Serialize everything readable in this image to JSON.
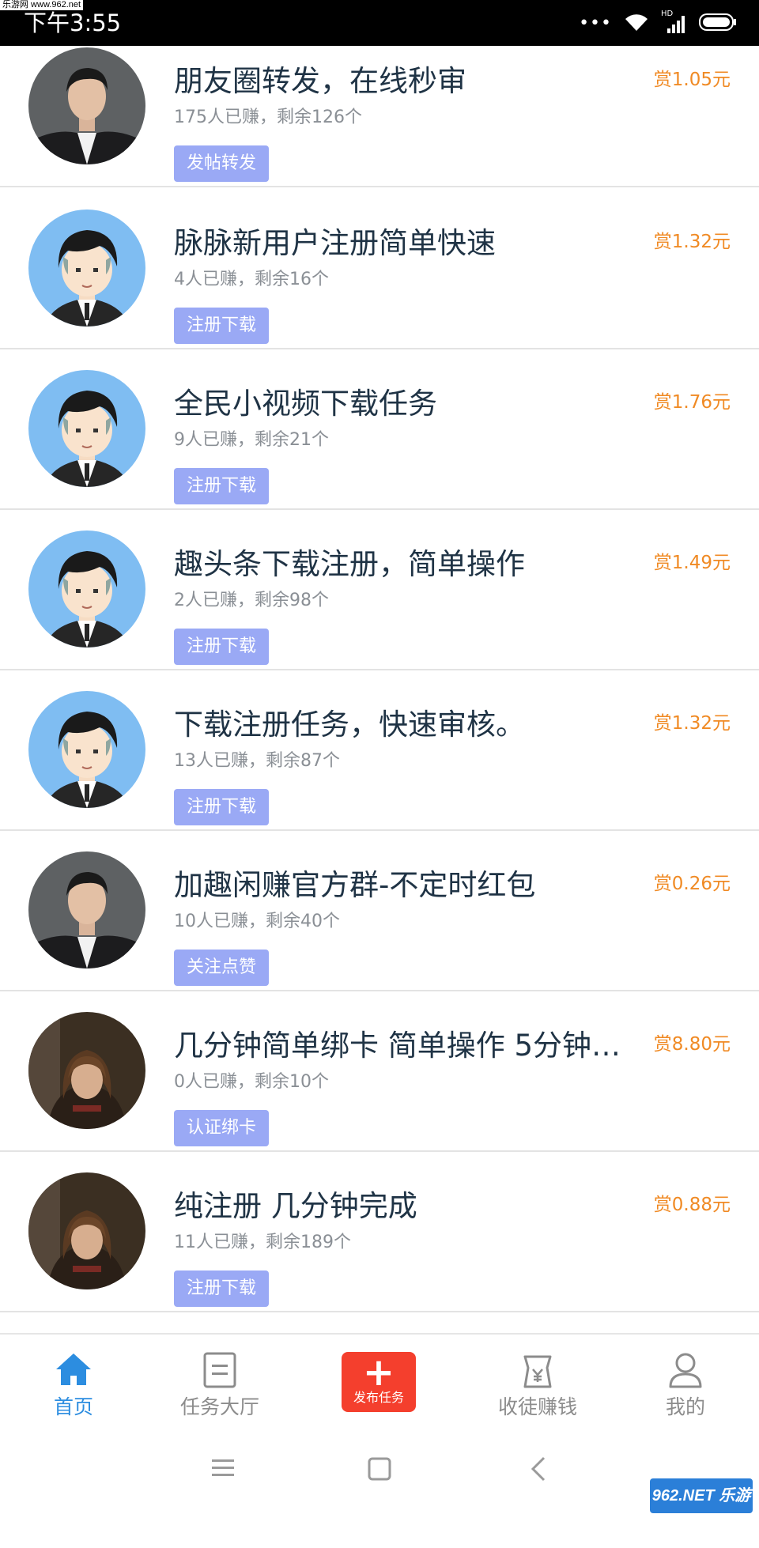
{
  "watermark_top": "乐游网 www.962.net",
  "status_bar": {
    "time": "下午3:55",
    "dots": "•••",
    "network": "HD"
  },
  "tasks": [
    {
      "title": "朋友圈转发，在线秒审",
      "meta": "175人已赚，剩余126个",
      "tag": "发帖转发",
      "reward": "赏1.05元",
      "avatar": "photo-man"
    },
    {
      "title": "脉脉新用户注册简单快速",
      "meta": "4人已赚，剩余16个",
      "tag": "注册下载",
      "reward": "赏1.32元",
      "avatar": "cartoon-man"
    },
    {
      "title": "全民小视频下载任务",
      "meta": "9人已赚，剩余21个",
      "tag": "注册下载",
      "reward": "赏1.76元",
      "avatar": "cartoon-man"
    },
    {
      "title": "趣头条下载注册，简单操作",
      "meta": "2人已赚，剩余98个",
      "tag": "注册下载",
      "reward": "赏1.49元",
      "avatar": "cartoon-man"
    },
    {
      "title": "下载注册任务，快速审核。",
      "meta": "13人已赚，剩余87个",
      "tag": "注册下载",
      "reward": "赏1.32元",
      "avatar": "cartoon-man"
    },
    {
      "title": "加趣闲赚官方群-不定时红包",
      "meta": "10人已赚，剩余40个",
      "tag": "关注点赞",
      "reward": "赏0.26元",
      "avatar": "photo-man"
    },
    {
      "title": "几分钟简单绑卡 简单操作 5分钟…",
      "meta": "0人已赚，剩余10个",
      "tag": "认证绑卡",
      "reward": "赏8.80元",
      "avatar": "photo-girl"
    },
    {
      "title": "纯注册 几分钟完成",
      "meta": "11人已赚，剩余189个",
      "tag": "注册下载",
      "reward": "赏0.88元",
      "avatar": "photo-girl"
    }
  ],
  "tabbar": {
    "home": "首页",
    "hall": "任务大厅",
    "publish": "发布任务",
    "apprentice": "收徒赚钱",
    "mine": "我的"
  },
  "watermark_bottom": "962.NET 乐游网",
  "colors": {
    "accent": "#2c8de0",
    "reward": "#f08a24",
    "tag_bg": "#9aa9f5",
    "publish_bg": "#f43f2d",
    "title": "#1f3345"
  }
}
